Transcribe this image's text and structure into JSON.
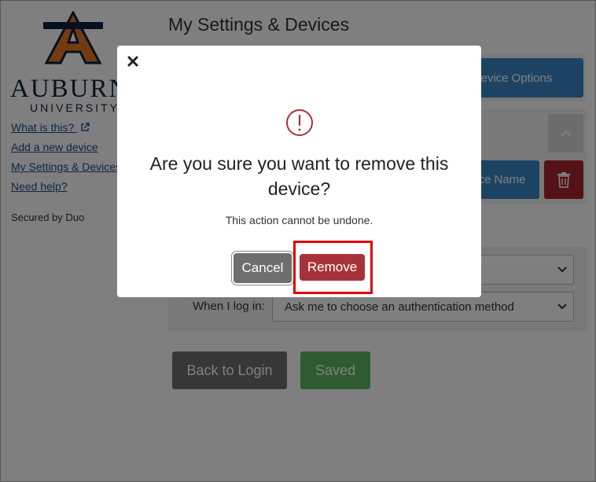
{
  "sidebar": {
    "logo_text": "AU",
    "wordmark": "AUBURN",
    "wordmark_sub": "UNIVERSITY",
    "links": [
      "What is this?",
      "Add a new device",
      "My Settings & Devices",
      "Need help?"
    ],
    "secured": "Secured by Duo"
  },
  "main": {
    "title": "My Settings & Devices",
    "device_options_label": "Device Options",
    "device_name_label": "Device Name",
    "login_label": "When I log in:",
    "login_select_value": "Ask me to choose an authentication method",
    "back_label": "Back to Login",
    "saved_label": "Saved"
  },
  "modal": {
    "heading": "Are you sure you want to remove this device?",
    "subtext": "This action cannot be undone.",
    "cancel_label": "Cancel",
    "remove_label": "Remove"
  },
  "colors": {
    "auburn_navy": "#0c2340",
    "auburn_orange": "#e87722",
    "primary_blue": "#3a87c8",
    "danger_red": "#a8252e",
    "success_green": "#5cb85c",
    "highlight_red": "#e00000"
  },
  "icons": [
    "close-icon",
    "warning-circle-icon",
    "external-link-icon",
    "trash-icon",
    "chevron-up-icon",
    "chevron-down-icon"
  ]
}
